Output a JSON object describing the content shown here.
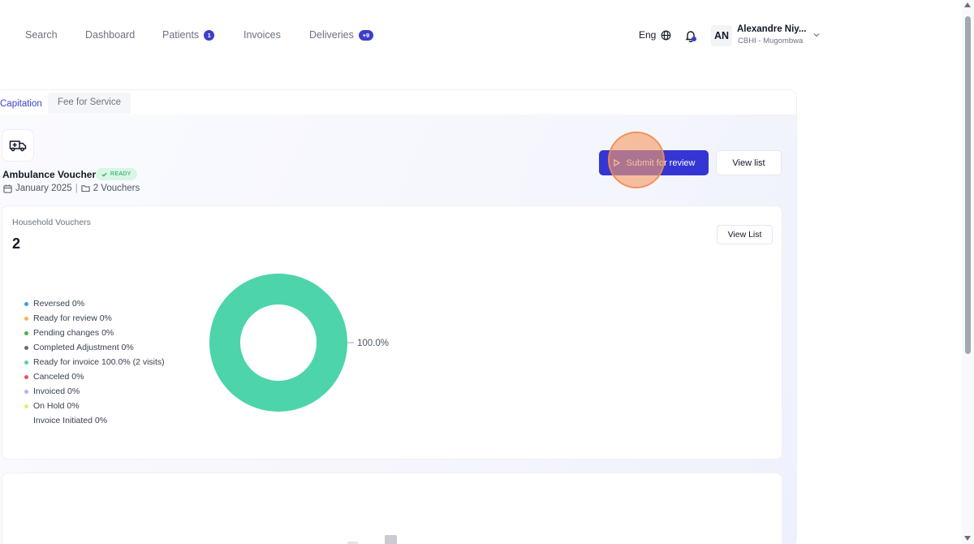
{
  "nav": {
    "items": [
      {
        "label": "Search"
      },
      {
        "label": "Dashboard"
      },
      {
        "label": "Patients",
        "badge": "1"
      },
      {
        "label": "Invoices"
      },
      {
        "label": "Deliveries",
        "badge": "+9"
      }
    ],
    "language": "Eng",
    "user": {
      "initials": "AN",
      "name": "Alexandre Niy...",
      "role": "CBHI - Mugombwa"
    }
  },
  "tabs": [
    {
      "label": "Capitation",
      "active": true
    },
    {
      "label": "Fee for Service",
      "active": false
    }
  ],
  "header": {
    "title": "Ambulance Vouchers",
    "status": "READY",
    "period": "January 2025",
    "vouchers": "2 Vouchers",
    "submit_label": "Submit for review",
    "view_label": "View list"
  },
  "household": {
    "title": "Household Vouchers",
    "count": "2",
    "view_label": "View List"
  },
  "chart_data": {
    "type": "pie",
    "legend": [
      {
        "label": "Reversed 0%",
        "color": "#3b9ee6"
      },
      {
        "label": "Ready for review 0%",
        "color": "#f5b84a"
      },
      {
        "label": "Pending changes 0%",
        "color": "#4caf50"
      },
      {
        "label": "Completed Adjustment 0%",
        "color": "#6b6b6b"
      },
      {
        "label": "Ready for invoice 100.0% (2 visits)",
        "color": "#4dd4aa"
      },
      {
        "label": "Canceled 0%",
        "color": "#ef5350"
      },
      {
        "label": "Invoiced 0%",
        "color": "#c9a7f0"
      },
      {
        "label": "On Hold 0%",
        "color": "#f0ea6c"
      },
      {
        "label": "Invoice Initiated 0%",
        "color": "#ffffff"
      }
    ],
    "slices": [
      {
        "name": "Ready for invoice",
        "value": 100.0,
        "label": "100.0%",
        "color": "#4dd4aa"
      }
    ]
  }
}
